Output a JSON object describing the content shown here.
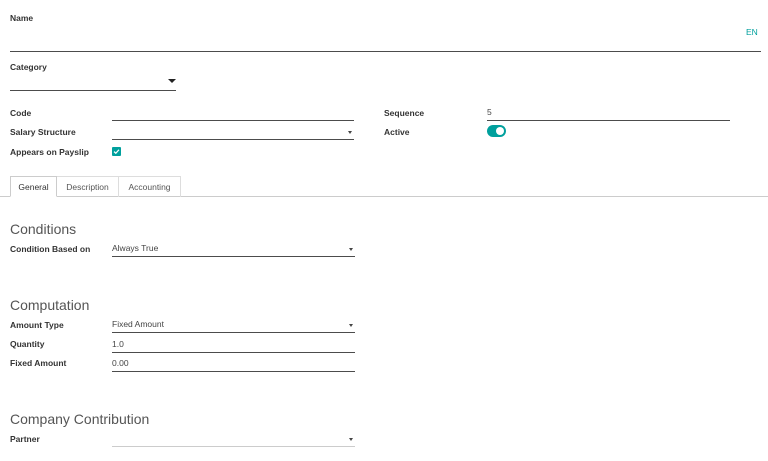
{
  "form": {
    "name_label": "Name",
    "lang_button": "EN",
    "category_label": "Category",
    "code_label": "Code",
    "code_value": "",
    "salary_structure_label": "Salary Structure",
    "appears_on_payslip_label": "Appears on Payslip",
    "sequence_label": "Sequence",
    "sequence_value": "5",
    "active_label": "Active"
  },
  "tabs": [
    {
      "label": "General",
      "active": true
    },
    {
      "label": "Description",
      "active": false
    },
    {
      "label": "Accounting",
      "active": false
    }
  ],
  "conditions": {
    "heading": "Conditions",
    "based_on_label": "Condition Based on",
    "based_on_value": "Always True"
  },
  "computation": {
    "heading": "Computation",
    "amount_type_label": "Amount Type",
    "amount_type_value": "Fixed Amount",
    "quantity_label": "Quantity",
    "quantity_value": "1.0",
    "fixed_amount_label": "Fixed Amount",
    "fixed_amount_value": "0.00"
  },
  "company_contribution": {
    "heading": "Company Contribution",
    "partner_label": "Partner"
  },
  "colors": {
    "accent": "#00a09d"
  }
}
